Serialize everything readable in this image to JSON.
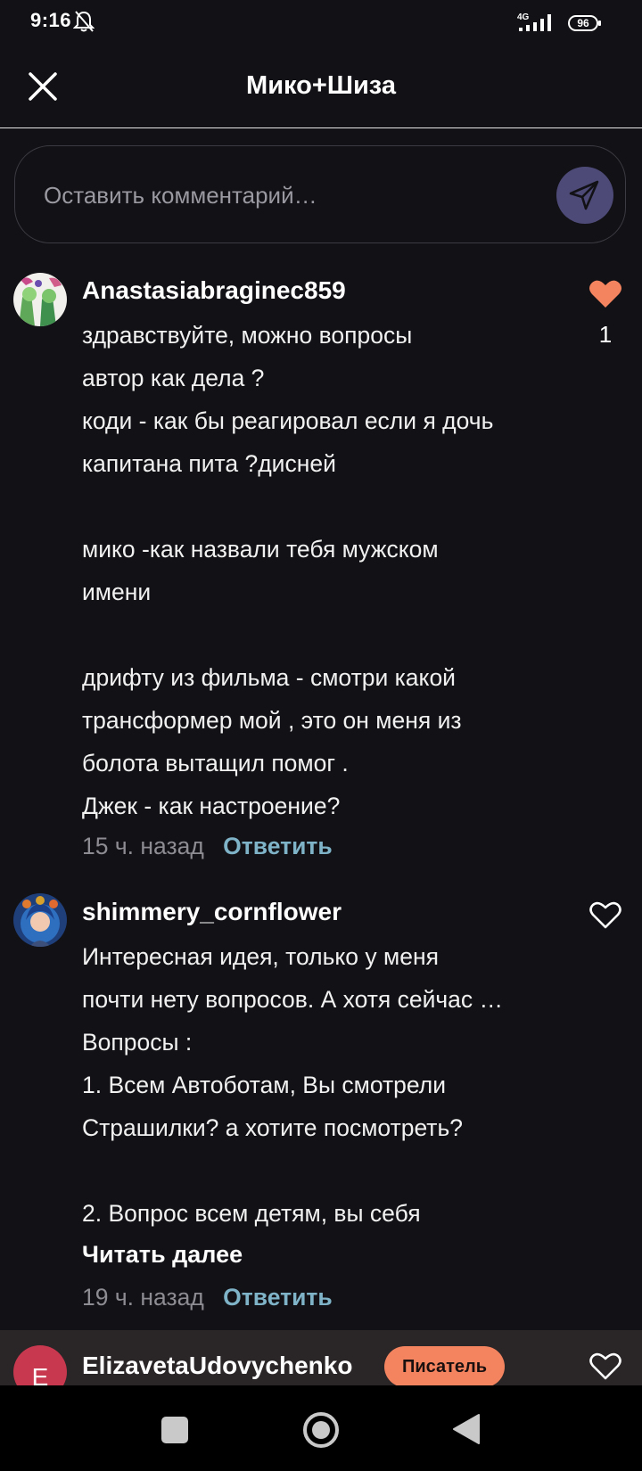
{
  "status_bar": {
    "time": "9:16",
    "network": "4G",
    "battery": "96"
  },
  "header": {
    "title": "Мико+Шиза",
    "close_icon": "close-icon"
  },
  "comment_input": {
    "placeholder": "Оставить комментарий…",
    "send_icon": "send-icon"
  },
  "comments": [
    {
      "author": "Anastasiabraginec859",
      "text": "здравствуйте, можно вопросы\nавтор как дела ?\nкоди - как бы реагировал если я дочь\nкапитана пита ?дисней\n\nмико -как назвали тебя мужском\nимени\n\nдрифту из фильма - смотри какой\nтрансформер мой , это он меня из\nболота вытащил помог .\nДжек - как настроение?",
      "time": "15 ч. назад",
      "reply_label": "Ответить",
      "likes": "1",
      "liked": true
    },
    {
      "author": "shimmery_cornflower",
      "text": "Интересная идея, только у меня\nпочти нету вопросов. А хотя сейчас …\nВопросы :\n1. Всем Автоботам, Вы смотрели\nСтрашилки? а хотите посмотреть?\n\n2. Вопрос всем детям, вы себя",
      "read_more": "Читать далее",
      "time": "19 ч. назад",
      "reply_label": "Ответить",
      "liked": false
    },
    {
      "author": "ElizavetaUdovychenko",
      "avatar_letter": "E",
      "badge": "Писатель",
      "liked": false
    }
  ],
  "colors": {
    "background": "#121115",
    "accent_like": "#f4845f",
    "reply": "#7fb3c8",
    "send_button": "#4d4a78",
    "badge": "#f4845f"
  }
}
